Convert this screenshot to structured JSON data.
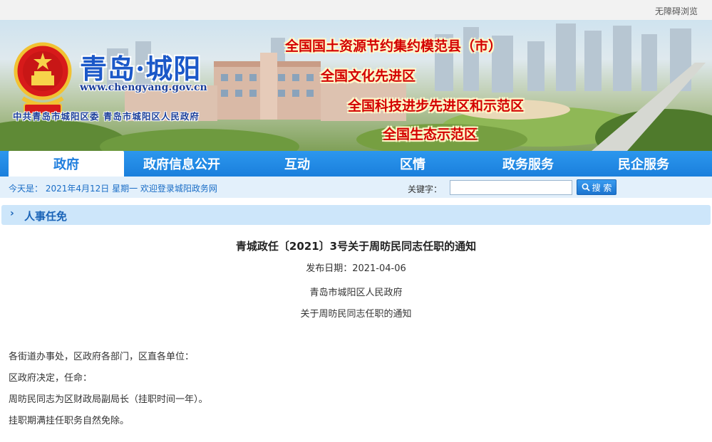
{
  "topbar": {
    "accessibility_label": "无障碍浏览"
  },
  "banner": {
    "site_name": "青岛·城阳",
    "site_url": "www.chengyang.gov.cn",
    "organizations": "中共青岛市城阳区委  青岛市城阳区人民政府",
    "honors": [
      "全国国土资源节约集约模范县（市）",
      "全国文化先进区",
      "全国科技进步先进区和示范区",
      "全国生态示范区"
    ]
  },
  "nav": {
    "items": [
      {
        "label": "政府",
        "active": true
      },
      {
        "label": "政府信息公开",
        "active": false
      },
      {
        "label": "互动",
        "active": false
      },
      {
        "label": "区情",
        "active": false
      },
      {
        "label": "政务服务",
        "active": false
      },
      {
        "label": "民企服务",
        "active": false
      }
    ]
  },
  "infobar": {
    "today_text": "今天是： 2021年4月12日 星期一 欢迎登录城阳政务网",
    "keyword_label": "关键字：",
    "keyword_value": "",
    "search_label": "搜 索"
  },
  "section": {
    "title": "人事任免"
  },
  "article": {
    "title": "青城政任〔2021〕3号关于周昉民同志任职的通知",
    "date_label": "发布日期：",
    "date_value": "2021-04-06",
    "issuer": "青岛市城阳区人民政府",
    "subtitle": "关于周昉民同志任职的通知",
    "paragraphs": [
      "各街道办事处，区政府各部门，区直各单位：",
      "区政府决定，任命：",
      "周昉民同志为区财政局副局长（挂职时间一年）。",
      "挂职期满挂任职务自然免除。"
    ]
  },
  "colors": {
    "nav_blue": "#1f7ede",
    "honor_red": "#d40000",
    "title_blue": "#1b58c8"
  }
}
